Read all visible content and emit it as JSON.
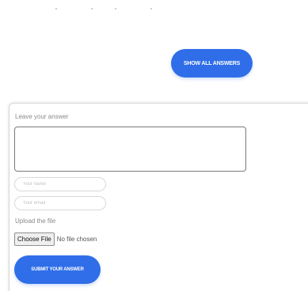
{
  "answers": {
    "show_all_label": "SHOW ALL ANSWERS"
  },
  "form": {
    "leave_label": "Leave your answer",
    "answer_value": "",
    "name_placeholder": "Your name",
    "email_placeholder": "Your email",
    "upload_label": "Upload the file",
    "choose_file_label": "Choose File",
    "file_status": "No file chosen",
    "submit_label": "SUBMIT YOUR ANSWER"
  },
  "colors": {
    "accent": "#2f6ee8",
    "border": "#d9d9d9",
    "muted_text": "#8a8a8a"
  }
}
